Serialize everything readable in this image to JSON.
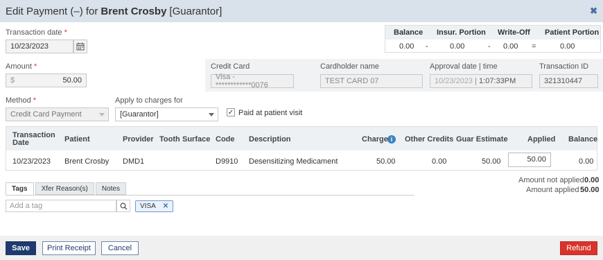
{
  "title": {
    "prefix": "Edit Payment (–) for",
    "name": "Brent Crosby",
    "role": "[Guarantor]"
  },
  "transaction_date": {
    "label": "Transaction date",
    "value": "10/23/2023"
  },
  "amount": {
    "label": "Amount",
    "currency": "$",
    "value": "50.00"
  },
  "balance_summary": {
    "headers": [
      "Balance",
      "Insur. Portion",
      "Write-Off",
      "Patient Portion"
    ],
    "values": [
      "0.00",
      "0.00",
      "0.00",
      "0.00"
    ],
    "operators": [
      "-",
      "-",
      "="
    ]
  },
  "credit_card": {
    "card_label": "Credit Card",
    "card_value": "Visa - ************0076",
    "holder_label": "Cardholder name",
    "holder_value": "TEST CARD 07",
    "approval_label": "Approval date | time",
    "approval_date": "10/23/2023",
    "approval_time": "1:07:33PM",
    "txn_label": "Transaction ID",
    "txn_value": "321310447"
  },
  "method": {
    "label": "Method",
    "value": "Credit Card Payment"
  },
  "apply_to": {
    "label": "Apply to charges for",
    "value": "[Guarantor]"
  },
  "paid_at_visit": {
    "label": "Paid at patient visit",
    "checked": true
  },
  "grid": {
    "headers": {
      "transaction_date_1": "Transaction",
      "transaction_date_2": "Date",
      "patient": "Patient",
      "provider": "Provider",
      "tooth": "Tooth",
      "surface": "Surface",
      "code": "Code",
      "description": "Description",
      "charge": "Charge",
      "other_credits": "Other Credits",
      "guar_estimate": "Guar Estimate",
      "applied": "Applied",
      "balance": "Balance"
    },
    "rows": [
      {
        "date": "10/23/2023",
        "patient": "Brent Crosby",
        "provider": "DMD1",
        "tooth": "",
        "surface": "",
        "code": "D9910",
        "description": "Desensitizing Medicament",
        "charge": "50.00",
        "other_credits": "0.00",
        "guar_estimate": "50.00",
        "applied": "50.00",
        "balance": "0.00"
      }
    ]
  },
  "summary": {
    "not_applied_label": "Amount not applied",
    "not_applied_value": "0.00",
    "applied_label": "Amount applied",
    "applied_value": "50.00"
  },
  "tabs": [
    "Tags",
    "Xfer Reason(s)",
    "Notes"
  ],
  "tags": {
    "placeholder": "Add a tag",
    "items": [
      "VISA"
    ]
  },
  "buttons": {
    "save": "Save",
    "print": "Print Receipt",
    "cancel": "Cancel",
    "refund": "Refund"
  },
  "colors": {
    "primary": "#1e3a6e",
    "danger": "#d9342b",
    "info": "#3b82c4"
  }
}
